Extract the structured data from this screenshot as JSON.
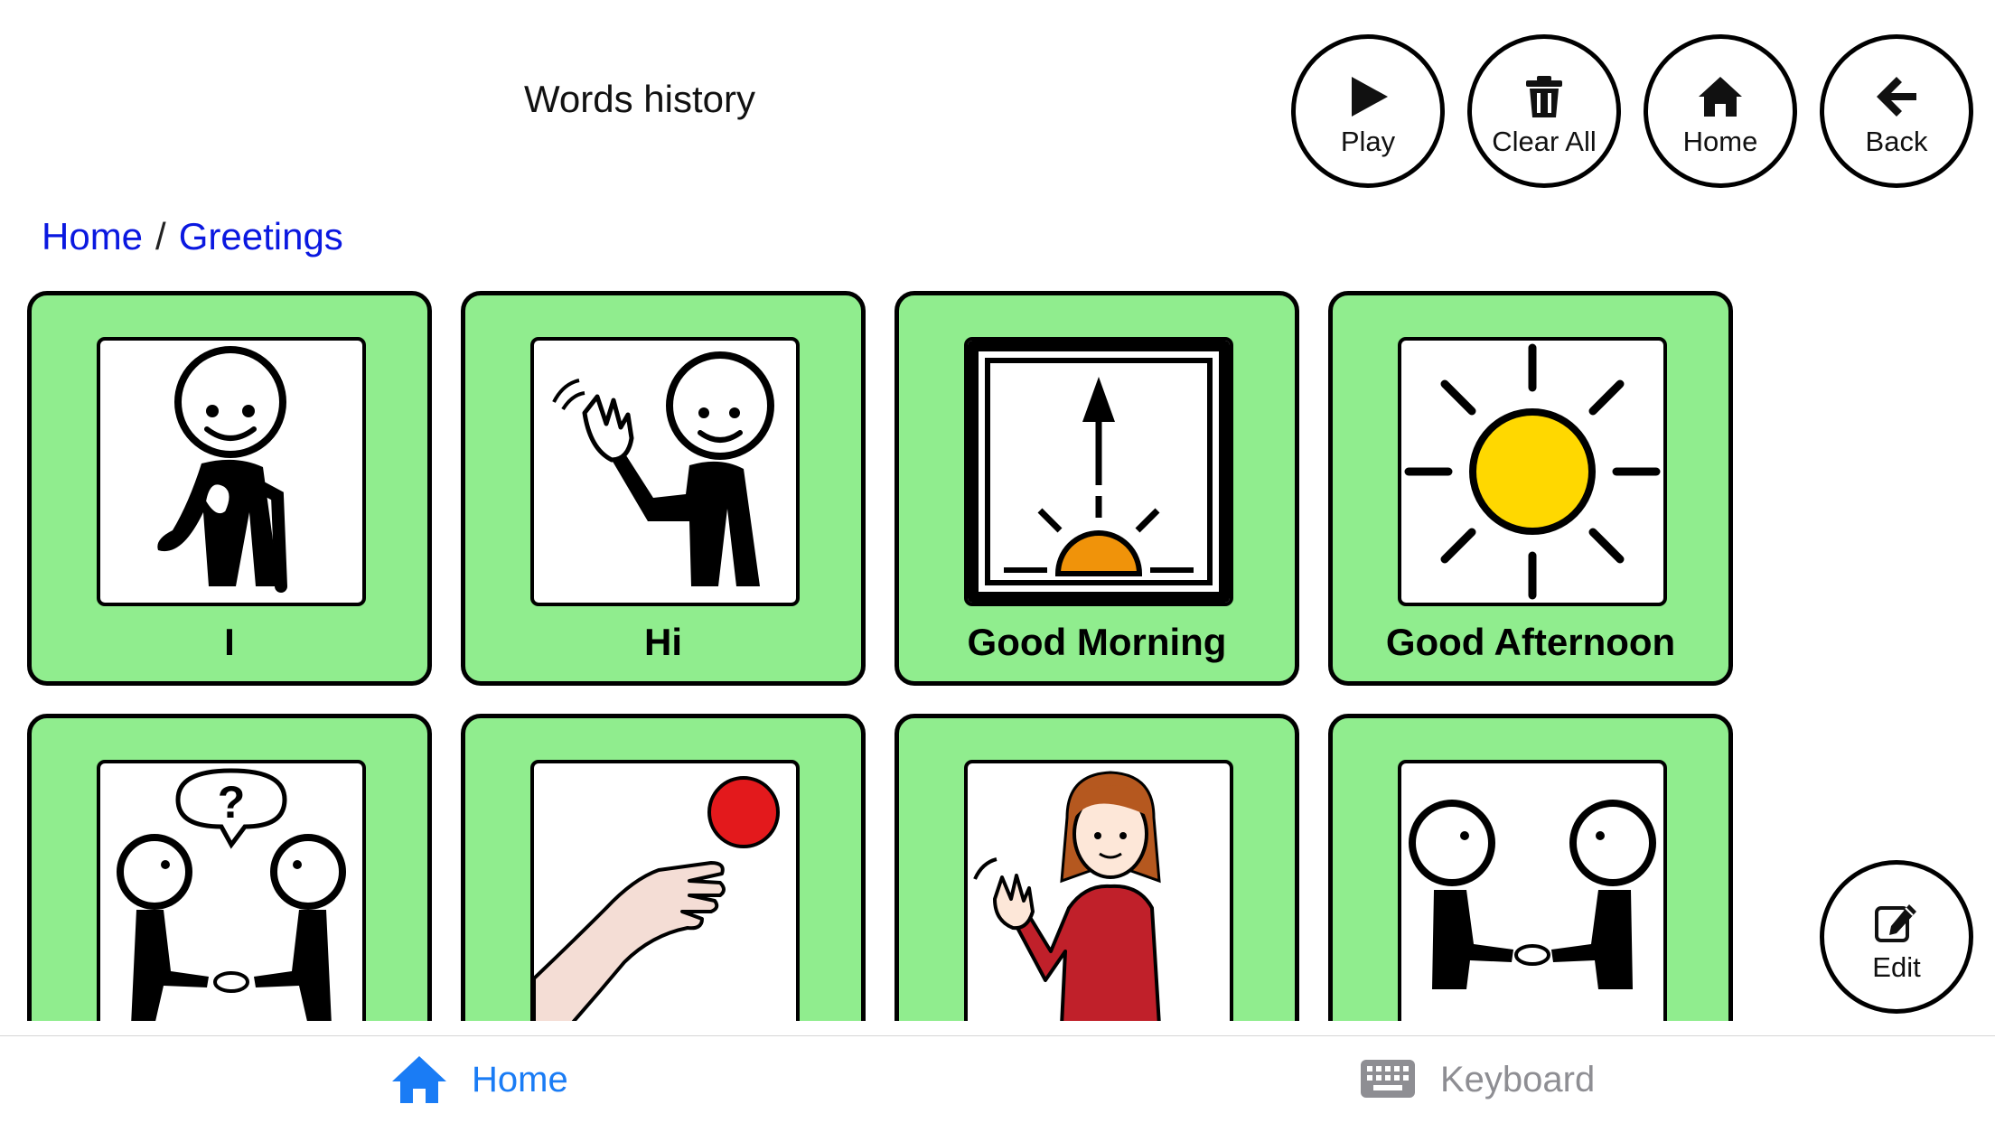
{
  "header": {
    "history_title": "Words history",
    "buttons": {
      "play": "Play",
      "clear_all": "Clear All",
      "home": "Home",
      "back": "Back"
    }
  },
  "breadcrumb": {
    "items": [
      "Home",
      "Greetings"
    ],
    "separator": "/"
  },
  "tiles": [
    {
      "label": "I",
      "symbol": "person-pointing-self"
    },
    {
      "label": "Hi",
      "symbol": "person-waving"
    },
    {
      "label": "Good Morning",
      "symbol": "sunrise"
    },
    {
      "label": "Good Afternoon",
      "symbol": "sun"
    },
    {
      "label": "",
      "symbol": "two-people-question-handshake"
    },
    {
      "label": "",
      "symbol": "hand-red-ball"
    },
    {
      "label": "",
      "symbol": "girl-waving"
    },
    {
      "label": "",
      "symbol": "two-people-handshake"
    }
  ],
  "edit_button": {
    "label": "Edit"
  },
  "tabbar": {
    "home": {
      "label": "Home",
      "icon": "house-icon",
      "active": true
    },
    "keyboard": {
      "label": "Keyboard",
      "icon": "keyboard-icon",
      "active": false
    }
  },
  "colors": {
    "tile_background": "#90ed8e",
    "breadcrumb_link": "#0a18e0",
    "tab_active": "#1a7cf5",
    "tab_inactive": "#8e8e93"
  }
}
